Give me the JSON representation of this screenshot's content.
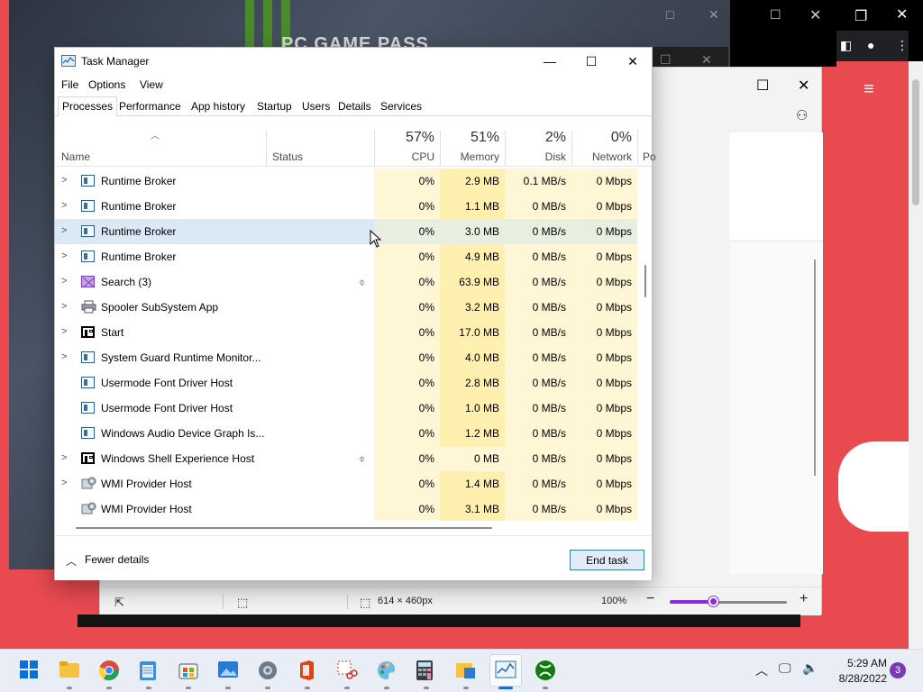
{
  "background": {
    "gamepass_text": "PC GAME PASS",
    "paint_status": {
      "size": "614 × 460px",
      "zoom": "100%",
      "zoom_slider_fraction": 0.38
    }
  },
  "task_manager": {
    "title": "Task Manager",
    "menu": [
      "File",
      "Options",
      "View"
    ],
    "tabs": [
      "Processes",
      "Performance",
      "App history",
      "Startup",
      "Users",
      "Details",
      "Services"
    ],
    "active_tab": "Processes",
    "columns": {
      "name": "Name",
      "status": "Status",
      "cpu": {
        "pct": "57%",
        "label": "CPU"
      },
      "memory": {
        "pct": "51%",
        "label": "Memory"
      },
      "disk": {
        "pct": "2%",
        "label": "Disk"
      },
      "network": {
        "pct": "0%",
        "label": "Network"
      },
      "power": "Po"
    },
    "rows": [
      {
        "name": "Runtime Broker",
        "expand": true,
        "icon": "app-window-icon",
        "cpu": "0%",
        "mem": "2.9 MB",
        "disk": "0.1 MB/s",
        "net": "0 Mbps"
      },
      {
        "name": "Runtime Broker",
        "expand": true,
        "icon": "app-window-icon",
        "cpu": "0%",
        "mem": "1.1 MB",
        "disk": "0 MB/s",
        "net": "0 Mbps"
      },
      {
        "name": "Runtime Broker",
        "expand": true,
        "icon": "app-window-icon",
        "cpu": "0%",
        "mem": "3.0 MB",
        "disk": "0 MB/s",
        "net": "0 Mbps",
        "highlighted": true
      },
      {
        "name": "Runtime Broker",
        "expand": true,
        "icon": "app-window-icon",
        "cpu": "0%",
        "mem": "4.9 MB",
        "disk": "0 MB/s",
        "net": "0 Mbps"
      },
      {
        "name": "Search (3)",
        "expand": true,
        "icon": "search-app-icon",
        "cpu": "0%",
        "mem": "63.9 MB",
        "disk": "0 MB/s",
        "net": "0 Mbps",
        "suspended": true
      },
      {
        "name": "Spooler SubSystem App",
        "expand": true,
        "icon": "printer-icon",
        "cpu": "0%",
        "mem": "3.2 MB",
        "disk": "0 MB/s",
        "net": "0 Mbps"
      },
      {
        "name": "Start",
        "expand": true,
        "icon": "start-app-icon",
        "cpu": "0%",
        "mem": "17.0 MB",
        "disk": "0 MB/s",
        "net": "0 Mbps"
      },
      {
        "name": "System Guard Runtime Monitor...",
        "expand": true,
        "icon": "app-window-icon",
        "cpu": "0%",
        "mem": "4.0 MB",
        "disk": "0 MB/s",
        "net": "0 Mbps"
      },
      {
        "name": "Usermode Font Driver Host",
        "expand": false,
        "icon": "app-window-icon",
        "cpu": "0%",
        "mem": "2.8 MB",
        "disk": "0 MB/s",
        "net": "0 Mbps"
      },
      {
        "name": "Usermode Font Driver Host",
        "expand": false,
        "icon": "app-window-icon",
        "cpu": "0%",
        "mem": "1.0 MB",
        "disk": "0 MB/s",
        "net": "0 Mbps"
      },
      {
        "name": "Windows Audio Device Graph Is...",
        "expand": false,
        "icon": "app-window-icon",
        "cpu": "0%",
        "mem": "1.2 MB",
        "disk": "0 MB/s",
        "net": "0 Mbps"
      },
      {
        "name": "Windows Shell Experience Host",
        "expand": true,
        "icon": "start-app-icon",
        "cpu": "0%",
        "mem": "0 MB",
        "disk": "0 MB/s",
        "net": "0 Mbps",
        "suspended": true
      },
      {
        "name": "WMI Provider Host",
        "expand": true,
        "icon": "gear-app-icon",
        "cpu": "0%",
        "mem": "1.4 MB",
        "disk": "0 MB/s",
        "net": "0 Mbps"
      },
      {
        "name": "WMI Provider Host",
        "expand": false,
        "icon": "gear-app-icon",
        "cpu": "0%",
        "mem": "3.1 MB",
        "disk": "0 MB/s",
        "net": "0 Mbps"
      }
    ],
    "footer": {
      "fewer_details": "Fewer details",
      "end_task": "End task"
    }
  },
  "taskbar": {
    "apps": [
      "windows-start-icon",
      "file-explorer-icon",
      "chrome-icon",
      "notepad-icon",
      "microsoft-store-icon",
      "photos-icon",
      "settings-icon",
      "office-icon",
      "snipping-tool-icon",
      "paint-icon",
      "calculator-icon",
      "file-manager-icon",
      "task-manager-icon",
      "xbox-icon"
    ],
    "active_app": "task-manager-icon",
    "time": "5:29 AM",
    "date": "8/28/2022",
    "notifications": "3"
  }
}
